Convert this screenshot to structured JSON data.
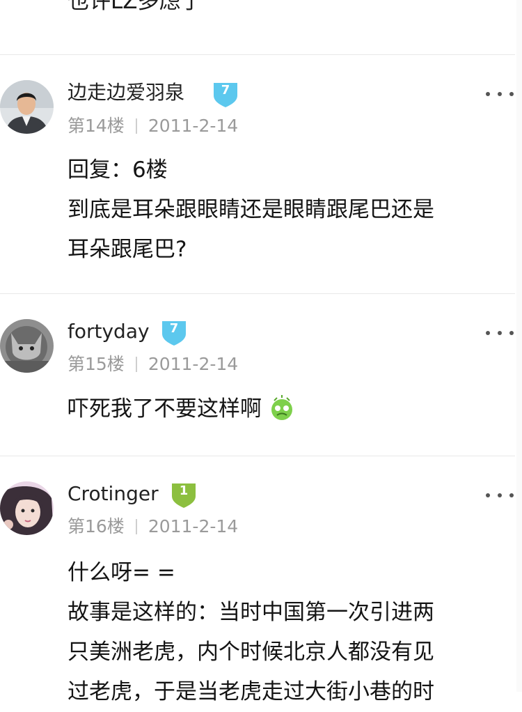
{
  "top_fragment": {
    "text": "也许LZ多虑了"
  },
  "posts": [
    {
      "username": "边走边爱羽泉",
      "level": "7",
      "floor": "第14楼",
      "date": "2011-2-14",
      "lines": [
        "回复：6楼",
        "到底是耳朵跟眼睛还是眼睛跟尾巴还是",
        "耳朵跟尾巴?"
      ]
    },
    {
      "username": "fortyday",
      "level": "7",
      "floor": "第15楼",
      "date": "2011-2-14",
      "lines": [
        "吓死我了不要这样啊"
      ]
    },
    {
      "username": "Crotinger",
      "level": "1",
      "floor": "第16楼",
      "date": "2011-2-14",
      "lines": [
        "什么呀= =",
        "故事是这样的：当时中国第一次引进两",
        "只美洲老虎，内个时候北京人都没有见",
        "过老虎，于是当老虎走过大街小巷的时"
      ]
    }
  ],
  "colors": {
    "badge_blue": "#5cc8ee",
    "badge_green": "#8cbf3f",
    "meta": "#9a9a9a",
    "divider": "#e8e8e8"
  },
  "icons": {
    "more": "more-dots-icon",
    "level_badge": "shield-badge-icon",
    "emoji": "dizzy-emoji-icon"
  }
}
